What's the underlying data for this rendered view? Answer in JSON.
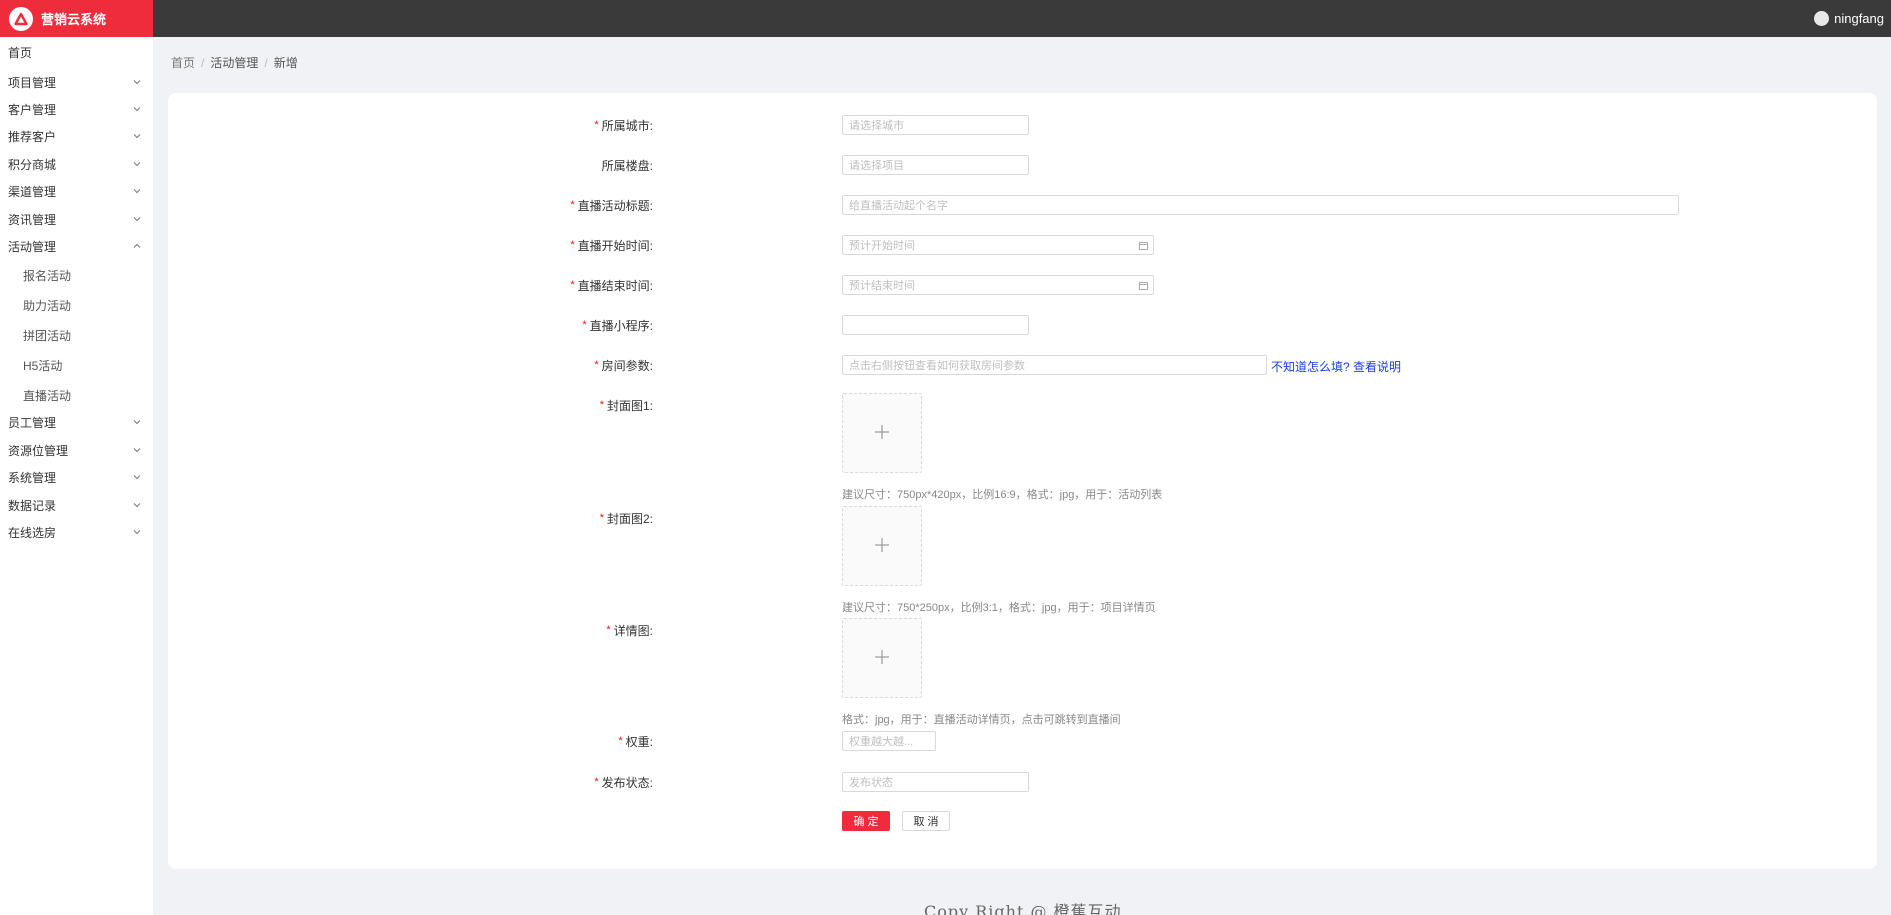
{
  "app": {
    "title": "营销云系统"
  },
  "user": {
    "name": "ningfang"
  },
  "sidebar": {
    "items": [
      {
        "label": "首页",
        "expandable": false
      },
      {
        "label": "项目管理",
        "expandable": true
      },
      {
        "label": "客户管理",
        "expandable": true
      },
      {
        "label": "推荐客户",
        "expandable": true
      },
      {
        "label": "积分商城",
        "expandable": true
      },
      {
        "label": "渠道管理",
        "expandable": true
      },
      {
        "label": "资讯管理",
        "expandable": true
      },
      {
        "label": "活动管理",
        "expandable": true,
        "expanded": true
      },
      {
        "label": "员工管理",
        "expandable": true
      },
      {
        "label": "资源位管理",
        "expandable": true
      },
      {
        "label": "系统管理",
        "expandable": true
      },
      {
        "label": "数据记录",
        "expandable": true
      },
      {
        "label": "在线选房",
        "expandable": true
      }
    ],
    "activity_sub_items": [
      "报名活动",
      "助力活动",
      "拼团活动",
      "H5活动",
      "直播活动"
    ]
  },
  "breadcrumb": {
    "home": "首页",
    "section": "活动管理",
    "current": "新增",
    "separator": "/"
  },
  "form": {
    "city": {
      "label": "所属城市:",
      "required": true,
      "placeholder": "请选择城市"
    },
    "building": {
      "label": "所属楼盘:",
      "required": false,
      "placeholder": "请选择项目"
    },
    "title": {
      "label": "直播活动标题:",
      "required": true,
      "placeholder": "给直播活动起个名字"
    },
    "start_time": {
      "label": "直播开始时间:",
      "required": true,
      "placeholder": "预计开始时间"
    },
    "end_time": {
      "label": "直播结束时间:",
      "required": true,
      "placeholder": "预计结束时间"
    },
    "mini_program": {
      "label": "直播小程序:",
      "required": true,
      "value": ""
    },
    "room_params": {
      "label": "房间参数:",
      "required": true,
      "placeholder": "点击右侧按钮查看如何获取房间参数",
      "help_link": "不知道怎么填? 查看说明"
    },
    "cover1": {
      "label": "封面图1:",
      "required": true,
      "hint": "建议尺寸：750px*420px，比例16:9，格式：jpg，用于：活动列表"
    },
    "cover2": {
      "label": "封面图2:",
      "required": true,
      "hint": "建议尺寸：750*250px，比例3:1，格式：jpg，用于：项目详情页"
    },
    "detail": {
      "label": "详情图:",
      "required": true,
      "hint": "格式：jpg，用于：直播活动详情页，点击可跳转到直播间"
    },
    "weight": {
      "label": "权重:",
      "required": true,
      "placeholder": "权重越大越..."
    },
    "status": {
      "label": "发布状态:",
      "required": true,
      "placeholder": "发布状态"
    },
    "required_mark": "*",
    "upload_plus": "+",
    "confirm_label": "确 定",
    "cancel_label": "取 消"
  },
  "footer": {
    "text": "Copy Right @ 橙蕉互动"
  },
  "colors": {
    "brand": "#ee2c3c",
    "topbar": "#3a3a3a",
    "link": "#1a3ee8",
    "required": "#e11111"
  },
  "icons": {
    "logo": "triangle-logo-icon",
    "chevron": "chevron-down-icon",
    "calendar": "calendar-icon",
    "plus": "plus-icon",
    "avatar": "avatar"
  }
}
